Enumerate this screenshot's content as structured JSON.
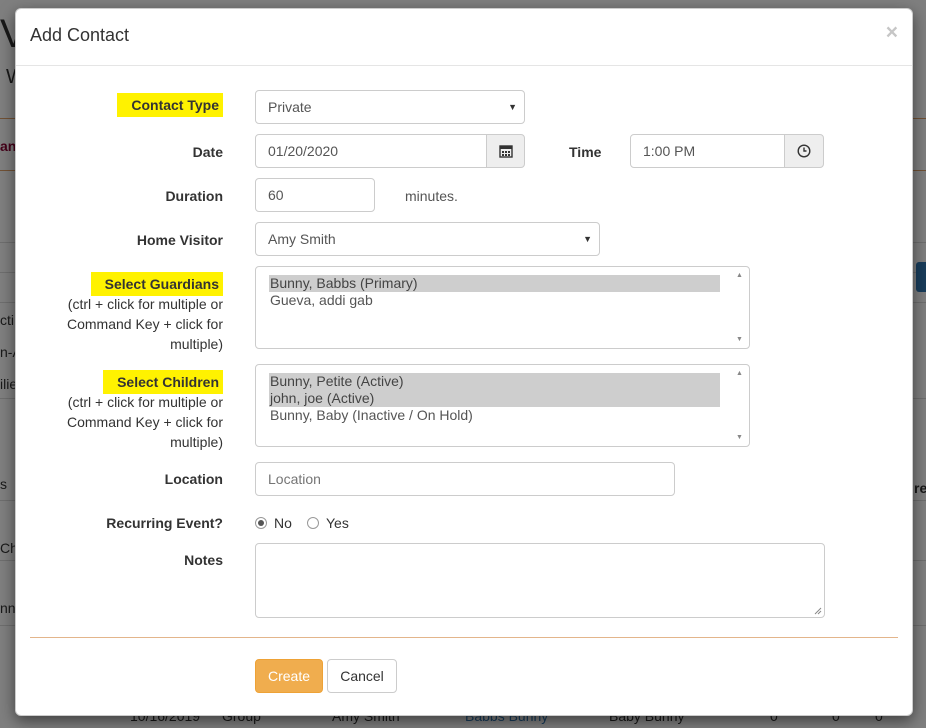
{
  "background": {
    "frag_w": "V",
    "frag_w2": "W",
    "frag_an": "an",
    "frag_cti": "cti",
    "frag_na": "n-A",
    "frag_mili": "ilie",
    "frag_s": "s",
    "frag_ch": "Ch",
    "frag_nn": "nn",
    "frag_re": "re",
    "row_date": "10/16/2019",
    "row_type": "Group",
    "row_visitor": "Amy Smith",
    "row_guardian": "Babbs Bunny",
    "row_child": "Baby Bunny",
    "row_n1": "0",
    "row_n2": "0",
    "row_n3": "0"
  },
  "modal": {
    "title": "Add Contact",
    "close": "×"
  },
  "form": {
    "contact_type_label": "Contact Type",
    "contact_type_value": "Private",
    "date_label": "Date",
    "date_value": "01/20/2020",
    "time_label": "Time",
    "time_value": "1:00 PM",
    "duration_label": "Duration",
    "duration_value": "60",
    "duration_unit": "minutes.",
    "home_visitor_label": "Home Visitor",
    "home_visitor_value": "Amy Smith",
    "guardians_label": "Select Guardians",
    "guardians_hint": "(ctrl + click for multiple or Command Key + click for multiple)",
    "guardians": [
      {
        "label": "Bunny, Babbs (Primary)",
        "selected": true
      },
      {
        "label": "Gueva, addi gab",
        "selected": false
      }
    ],
    "children_label": "Select Children",
    "children_hint": "(ctrl + click for multiple or Command Key + click for multiple)",
    "children": [
      {
        "label": "Bunny, Petite (Active)",
        "selected": true
      },
      {
        "label": "john, joe (Active)",
        "selected": true
      },
      {
        "label": "Bunny, Baby (Inactive / On Hold)",
        "selected": false
      }
    ],
    "location_label": "Location",
    "location_placeholder": "Location",
    "recurring_label": "Recurring Event?",
    "recurring_no": "No",
    "recurring_yes": "Yes",
    "recurring_selected": "No",
    "notes_label": "Notes"
  },
  "buttons": {
    "create": "Create",
    "cancel": "Cancel"
  },
  "colors": {
    "highlight": "#fff200",
    "primary": "#f0ad4e",
    "divider": "#e3b58b"
  }
}
